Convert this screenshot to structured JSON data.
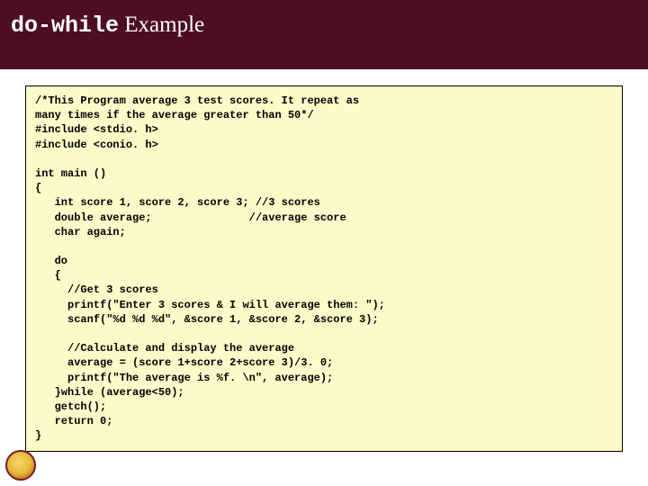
{
  "title": {
    "mono": "do-while",
    "serif": " Example"
  },
  "code": "/*This Program average 3 test scores. It repeat as\nmany times if the average greater than 50*/\n#include <stdio. h>\n#include <conio. h>\n\nint main ()\n{\n   int score 1, score 2, score 3; //3 scores\n   double average;               //average score\n   char again;\n\n   do\n   {\n     //Get 3 scores\n     printf(\"Enter 3 scores & I will average them: \");\n     scanf(\"%d %d %d\", &score 1, &score 2, &score 3);\n\n     //Calculate and display the average\n     average = (score 1+score 2+score 3)/3. 0;\n     printf(\"The average is %f. \\n\", average);\n   }while (average<50);\n   getch();\n   return 0;\n}"
}
